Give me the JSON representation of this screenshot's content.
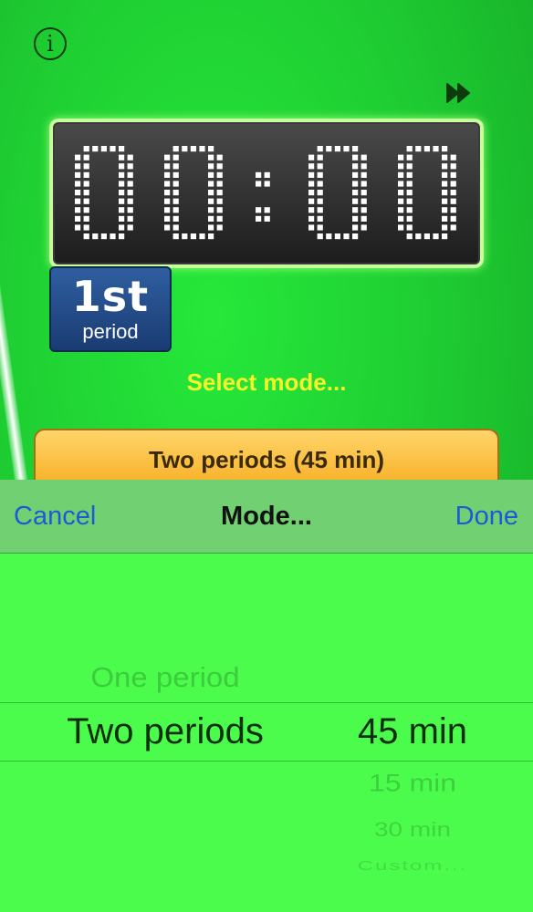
{
  "info_glyph": "i",
  "timer": {
    "digits": [
      "0",
      "0",
      "0",
      "0"
    ],
    "separator": ":"
  },
  "period": {
    "number": "1st",
    "label": "period"
  },
  "select_mode_label": "Select mode...",
  "mode_button_label": "Two periods (45 min)",
  "picker": {
    "toolbar": {
      "cancel": "Cancel",
      "title": "Mode...",
      "done": "Done"
    },
    "left_column": {
      "above": "One period",
      "selected": "Two periods"
    },
    "right_column": {
      "selected": "45 min",
      "below": [
        "15 min",
        "30 min",
        "Custom..."
      ]
    }
  },
  "colors": {
    "background": "#1fcf33",
    "select_label": "#f4f42a",
    "toolbar_link": "#1c5ad8",
    "led_dot": "#ffffff",
    "mode_button": "#f7ad20",
    "period_badge": "#1a3c73"
  },
  "icons": {
    "info": "info-icon",
    "fast_forward": "fast-forward-icon"
  }
}
